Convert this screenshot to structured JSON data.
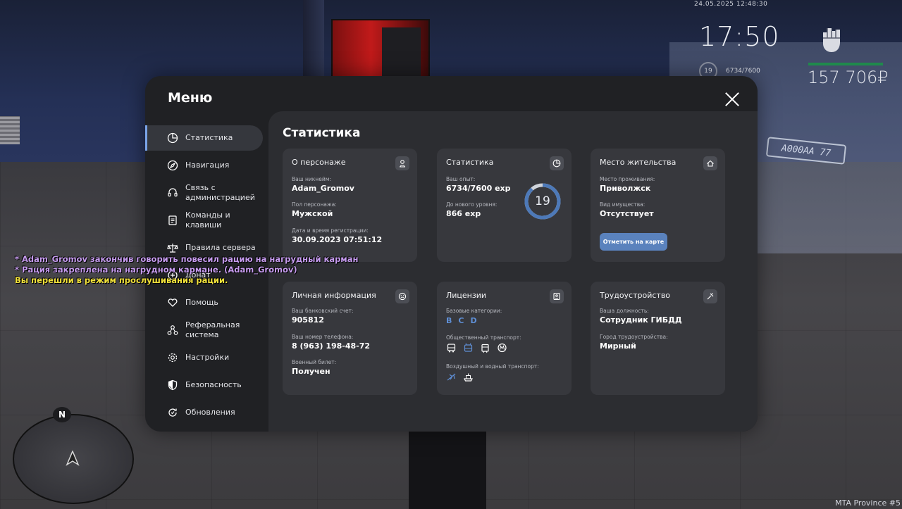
{
  "hud": {
    "datetime": "24.05.2025 12:48:30",
    "clock": "17:50",
    "level": "19",
    "exp": "6734/7600",
    "money": "157 706₽",
    "server": "MTA Province #5"
  },
  "scene": {
    "plate": "A000AA 77"
  },
  "minimap": {
    "north": "N"
  },
  "chat": {
    "lines": [
      "* Adam_Gromov закончив говорить повесил рацию на нагрудный карман",
      "* Рация закреплена на нагрудном кармане. (Adam_Gromov)",
      "Вы перешли в режим прослушивания рации."
    ]
  },
  "menu": {
    "title": "Меню",
    "sidebar": [
      {
        "label": "Статистика",
        "icon": "pie-chart-icon"
      },
      {
        "label": "Навигация",
        "icon": "compass-icon"
      },
      {
        "label": "Связь с администрацией",
        "icon": "headset-icon"
      },
      {
        "label": "Команды и клавиши",
        "icon": "keyboard-icon"
      },
      {
        "label": "Правила сервера",
        "icon": "scales-icon"
      },
      {
        "label": "Донат",
        "icon": "donate-icon"
      },
      {
        "label": "Помощь",
        "icon": "heart-hand-icon"
      },
      {
        "label": "Реферальная система",
        "icon": "referral-icon"
      },
      {
        "label": "Настройки",
        "icon": "gear-icon"
      },
      {
        "label": "Безопасность",
        "icon": "shield-icon"
      },
      {
        "label": "Обновления",
        "icon": "refresh-icon"
      }
    ],
    "section_title": "Статистика",
    "cards": {
      "character": {
        "title": "О персонаже",
        "nickname_label": "Ваш никнейм:",
        "nickname": "Adam_Gromov",
        "gender_label": "Пол персонажа:",
        "gender": "Мужской",
        "reg_label": "Дата и время регистрации:",
        "reg": "30.09.2023 07:51:12"
      },
      "stats": {
        "title": "Статистика",
        "exp_label": "Ваш опыт:",
        "exp": "6734/7600 exp",
        "next_label": "До нового уровня:",
        "next": "866 exp",
        "level": "19",
        "progress": 0.886
      },
      "residence": {
        "title": "Место жительства",
        "place_label": "Место проживания:",
        "place": "Приволжск",
        "property_label": "Вид имущества:",
        "property": "Отсутствует",
        "button": "Отметить на карте"
      },
      "personal": {
        "title": "Личная информация",
        "bank_label": "Ваш банковский счет:",
        "bank": "905812",
        "phone_label": "Ваш номер телефона:",
        "phone": "8 (963) 198-48-72",
        "military_label": "Военный билет:",
        "military": "Получен"
      },
      "licenses": {
        "title": "Лицензии",
        "base_label": "Базовые категории:",
        "categories": [
          "B",
          "C",
          "D"
        ],
        "public_label": "Общественный транспорт:",
        "air_label": "Воздушный и водный транспорт:"
      },
      "job": {
        "title": "Трудоустройство",
        "position_label": "Ваша должность:",
        "position": "Сотрудник ГИБДД",
        "city_label": "Город трудоустройства:",
        "city": "Мирный"
      }
    }
  },
  "colors": {
    "accent": "#5a82bd",
    "card": "#37383d",
    "panel": "#2c2d31",
    "window": "#202124"
  }
}
